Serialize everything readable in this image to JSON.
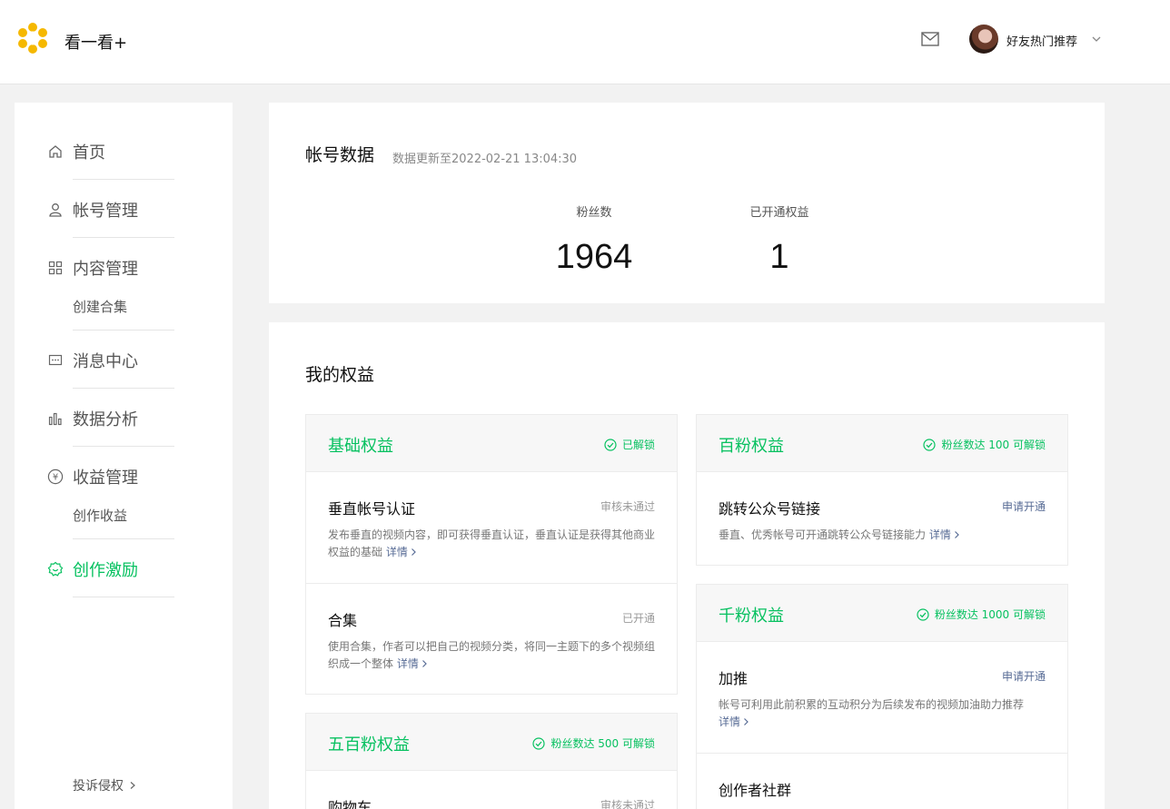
{
  "header": {
    "app_title": "看一看+",
    "user_name": "好友热门推荐",
    "icons": {
      "logo": "flower-logo-icon",
      "mail": "mail-icon",
      "caret": "chevron-down-icon"
    }
  },
  "sidebar": {
    "items": [
      {
        "label": "首页",
        "icon": "home-icon"
      },
      {
        "label": "帐号管理",
        "icon": "user-icon"
      },
      {
        "label": "内容管理",
        "icon": "grid-icon",
        "sub": "创建合集"
      },
      {
        "label": "消息中心",
        "icon": "message-icon"
      },
      {
        "label": "数据分析",
        "icon": "bar-chart-icon"
      },
      {
        "label": "收益管理",
        "icon": "yuan-icon",
        "sub": "创作收益"
      },
      {
        "label": "创作激励",
        "icon": "reward-icon",
        "active": true
      }
    ],
    "footer_link": "投诉侵权"
  },
  "account_data": {
    "title": "帐号数据",
    "updated": "数据更新至2022-02-21 13:04:30",
    "stats": [
      {
        "label": "粉丝数",
        "value": "1964"
      },
      {
        "label": "已开通权益",
        "value": "1"
      }
    ]
  },
  "rights": {
    "title": "我的权益",
    "detail_label": "详情",
    "tiers": [
      {
        "name": "基础权益",
        "status": "已解锁",
        "items": [
          {
            "name": "垂直帐号认证",
            "status": "审核未通过",
            "desc": "发布垂直的视频内容，即可获得垂直认证，垂直认证是获得其他商业权益的基础"
          },
          {
            "name": "合集",
            "status": "已开通",
            "desc": "使用合集，作者可以把自己的视频分类，将同一主题下的多个视频组织成一个整体"
          }
        ]
      },
      {
        "name": "五百粉权益",
        "status": "粉丝数达 500 可解锁",
        "items": [
          {
            "name": "购物车",
            "status": "审核未通过",
            "desc": ""
          }
        ]
      },
      {
        "name": "百粉权益",
        "status": "粉丝数达 100 可解锁",
        "items": [
          {
            "name": "跳转公众号链接",
            "status": "申请开通",
            "desc": "垂直、优秀帐号可开通跳转公众号链接能力"
          }
        ]
      },
      {
        "name": "千粉权益",
        "status": "粉丝数达 1000 可解锁",
        "items": [
          {
            "name": "加推",
            "status": "申请开通",
            "desc": "帐号可利用此前积累的互动积分为后续发布的视频加油助力推荐"
          },
          {
            "name": "创作者社群",
            "status": "",
            "desc": ""
          }
        ]
      }
    ]
  },
  "colors": {
    "accent": "#07c160",
    "link": "#576b95",
    "logo": "#f5b800"
  }
}
